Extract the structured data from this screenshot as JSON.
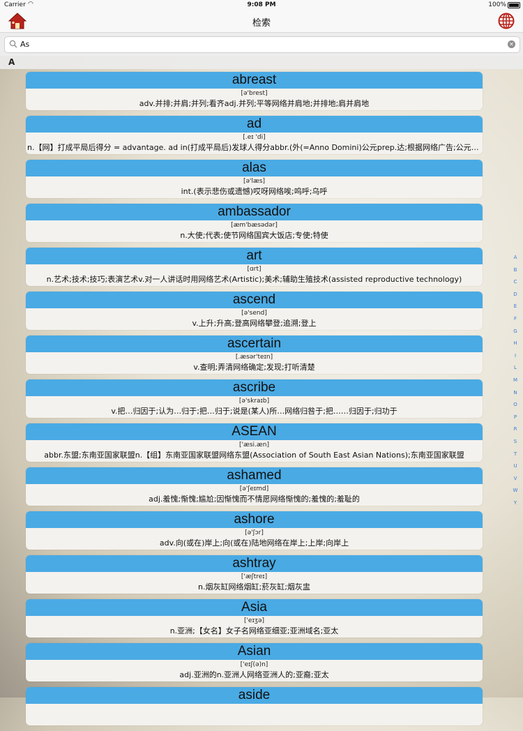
{
  "status_bar": {
    "carrier": "Carrier",
    "time": "9:08 PM",
    "battery": "100%"
  },
  "nav": {
    "title": "检索",
    "left_icon": "home-icon",
    "right_icon": "globe-icon"
  },
  "search": {
    "value": "As",
    "placeholder": ""
  },
  "section": {
    "header": "A"
  },
  "entries": [
    {
      "word": "abreast",
      "phonetic": "[ə'brest]",
      "definition": "adv.并排;并肩;并列;看齐adj.并列;平等网络并肩地;并排地;肩并肩地"
    },
    {
      "word": "ad",
      "phonetic": "[.eɪ 'di]",
      "definition": "n.【网】打成平局后得分 = advantage. ad in(打成平局后)发球人得分abbr.(外(=Anno Domini)公元prep.达;根据网络广告;公元;行政部门"
    },
    {
      "word": "alas",
      "phonetic": "[ə'læs]",
      "definition": "int.(表示悲伤或遗憾)哎呀网络唉;呜呼;乌呼"
    },
    {
      "word": "ambassador",
      "phonetic": "[æm'bæsədər]",
      "definition": "n.大使;代表;使节网络国宾大饭店;专使;特使"
    },
    {
      "word": "art",
      "phonetic": "[ɑrt]",
      "definition": "n.艺术;技术;技巧;表演艺术v.对一人讲话时用网络艺术(Artistic);美术;辅助生殖技术(assisted reproductive technology)"
    },
    {
      "word": "ascend",
      "phonetic": "[ə'send]",
      "definition": "v.上升;升高;登高网络攀登;追溯;登上"
    },
    {
      "word": "ascertain",
      "phonetic": "[.æsər'teɪn]",
      "definition": "v.查明;弄清网络确定;发现;打听清楚"
    },
    {
      "word": "ascribe",
      "phonetic": "[ə'skraɪb]",
      "definition": "v.把…归因于;认为…归于;把…归于;说是(某人)所…网络归咎于;把……归因于;归功于"
    },
    {
      "word": "ASEAN",
      "phonetic": "['æsi.æn]",
      "definition": "abbr.东盟;东南亚国家联盟n.【组】东南亚国家联盟网络东盟(Association of South East Asian Nations);东南亚国家联盟"
    },
    {
      "word": "ashamed",
      "phonetic": "[ə'ʃeɪmd]",
      "definition": "adj.羞愧;惭愧;尴尬;因惭愧而不情愿网络惭愧的;羞愧的;羞耻的"
    },
    {
      "word": "ashore",
      "phonetic": "[ə'ʃɔr]",
      "definition": "adv.向(或在)岸上;向(或在)陆地网络在岸上;上岸;向岸上"
    },
    {
      "word": "ashtray",
      "phonetic": "['æʃtreɪ]",
      "definition": "n.烟灰缸网络烟缸;菸灰缸;烟灰盅"
    },
    {
      "word": "Asia",
      "phonetic": "['eɪʒə]",
      "definition": "n.亚洲;【女名】女子名网络亚细亚;亚洲域名;亚太"
    },
    {
      "word": "Asian",
      "phonetic": "['eɪʃ(ə)n]",
      "definition": "adj.亚洲的n.亚洲人网络亚洲人的;亚裔;亚太"
    },
    {
      "word": "aside",
      "phonetic": "",
      "definition": ""
    }
  ],
  "index_letters": [
    "A",
    "B",
    "C",
    "D",
    "E",
    "F",
    "G",
    "H",
    "I",
    "L",
    "M",
    "N",
    "O",
    "P",
    "R",
    "S",
    "T",
    "U",
    "V",
    "W",
    "Y"
  ]
}
